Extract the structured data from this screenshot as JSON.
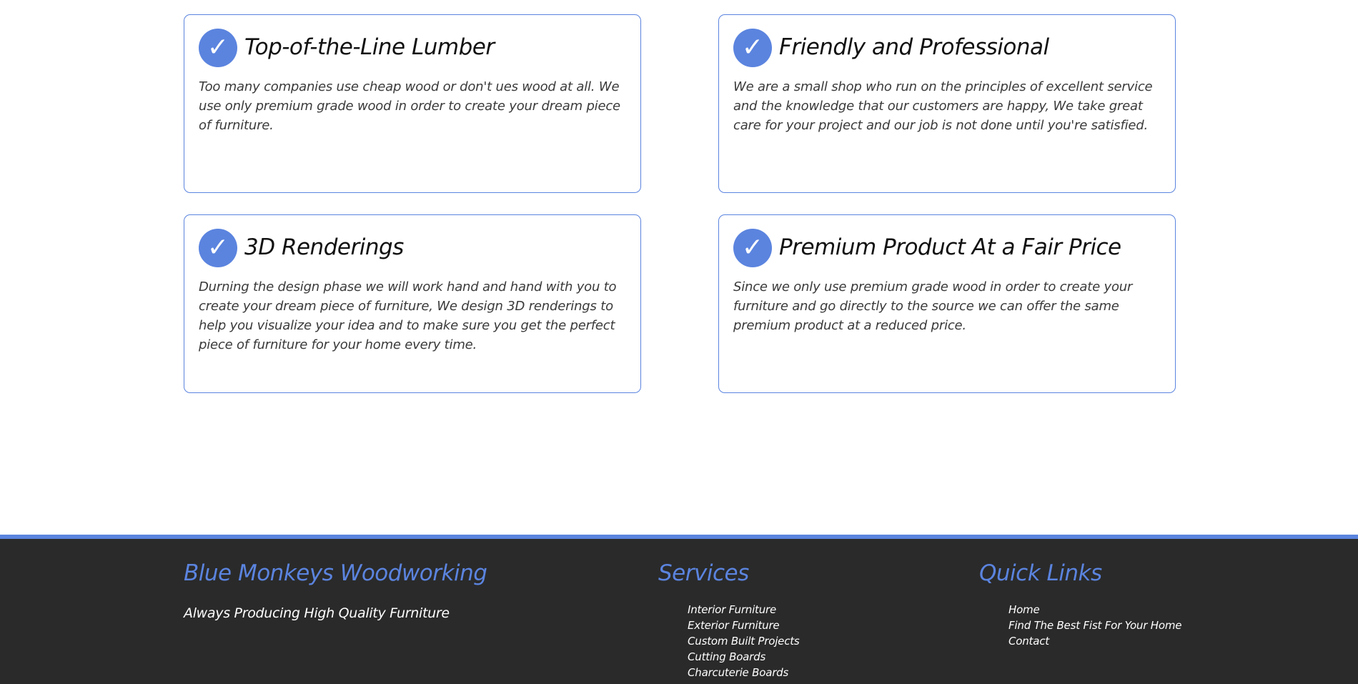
{
  "features": [
    {
      "icon": "check-icon",
      "title": "Top-of-the-Line Lumber",
      "text": "Too many companies use cheap wood or don't ues wood at all. We use only premium grade wood in order to create your dream piece of furniture."
    },
    {
      "icon": "check-icon",
      "title": "Friendly and Professional",
      "text": "We are a small shop who run on the principles of excellent service and the knowledge that our customers are happy, We take great care for your project and our job is not done until you're satisfied."
    },
    {
      "icon": "check-icon",
      "title": "3D Renderings",
      "text": "Durning the design phase we will work hand and hand with you to create your dream piece of furniture, We design 3D renderings to help you visualize your idea and to make sure you get the perfect piece of furniture for your home every time."
    },
    {
      "icon": "check-icon",
      "title": "Premium Product At a Fair Price",
      "text": "Since we only use premium grade wood in order to create your furniture and go directly to the source we can offer the same premium product at a reduced price."
    }
  ],
  "footer": {
    "brand": {
      "title": "Blue Monkeys Woodworking",
      "tagline": "Always Producing High Quality Furniture"
    },
    "services": {
      "title": "Services",
      "items": [
        "Interior Furniture",
        "Exterior Furniture",
        "Custom Built Projects",
        "Cutting Boards",
        "Charcuterie Boards"
      ]
    },
    "quick_links": {
      "title": "Quick Links",
      "items": [
        "Home",
        "Find The Best Fist For Your Home",
        "Contact"
      ]
    }
  },
  "colors": {
    "accent": "#5b84df",
    "footer_bg": "#2a2a2a",
    "text": "#3a3a3a"
  }
}
